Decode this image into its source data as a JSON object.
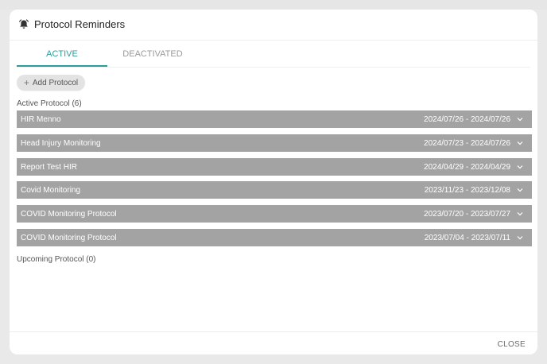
{
  "modal": {
    "title": "Protocol Reminders",
    "icon": "bell-icon"
  },
  "tabs": [
    {
      "label": "ACTIVE",
      "active": true
    },
    {
      "label": "DEACTIVATED",
      "active": false
    }
  ],
  "add_button": {
    "label": "Add Protocol",
    "icon": "plus-icon"
  },
  "active_section": {
    "label": "Active Protocol (6)"
  },
  "protocols": [
    {
      "name": "HIR Menno",
      "dates": "2024/07/26 - 2024/07/26"
    },
    {
      "name": "Head Injury Monitoring",
      "dates": "2024/07/23 - 2024/07/26"
    },
    {
      "name": "Report Test HIR",
      "dates": "2024/04/29 - 2024/04/29"
    },
    {
      "name": "Covid Monitoring",
      "dates": "2023/11/23 - 2023/12/08"
    },
    {
      "name": "COVID Monitoring Protocol",
      "dates": "2023/07/20 - 2023/07/27"
    },
    {
      "name": "COVID Monitoring Protocol",
      "dates": "2023/07/04 - 2023/07/11"
    }
  ],
  "upcoming_section": {
    "label": "Upcoming Protocol (0)"
  },
  "footer": {
    "close_label": "CLOSE"
  },
  "colors": {
    "accent": "#2a9d9a",
    "row_background": "#a3a3a3",
    "button_background": "#e3e3e3"
  }
}
